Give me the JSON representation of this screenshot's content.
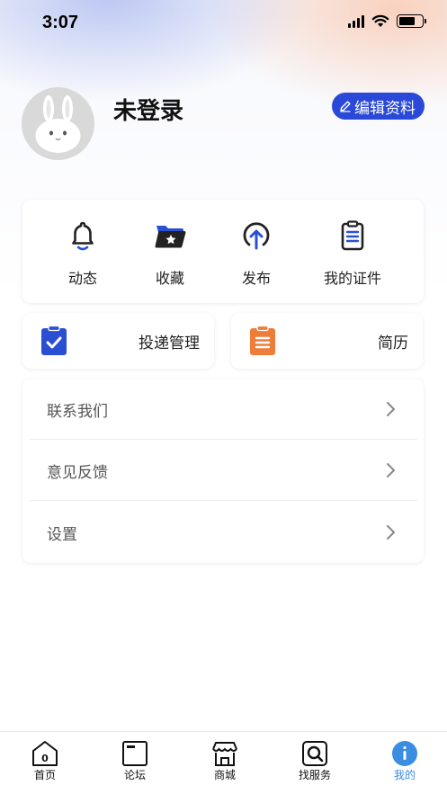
{
  "status_bar": {
    "time": "3:07"
  },
  "profile": {
    "username": "未登录",
    "edit_label": "编辑资料"
  },
  "quick_actions": [
    {
      "label": "动态",
      "icon": "bell-icon"
    },
    {
      "label": "收藏",
      "icon": "folder-star-icon"
    },
    {
      "label": "发布",
      "icon": "upload-circle-icon"
    },
    {
      "label": "我的证件",
      "icon": "clipboard-list-icon"
    }
  ],
  "cards": {
    "delivery": {
      "label": "投递管理",
      "icon": "clipboard-check-icon",
      "color": "#2b4fd3"
    },
    "resume": {
      "label": "简历",
      "icon": "clipboard-document-icon",
      "color": "#ee7d3a"
    }
  },
  "menu": [
    {
      "label": "联系我们"
    },
    {
      "label": "意见反馈"
    },
    {
      "label": "设置"
    }
  ],
  "tabbar": {
    "tabs": [
      {
        "label": "首页",
        "icon": "home-icon",
        "badge": "0"
      },
      {
        "label": "论坛",
        "icon": "forum-icon"
      },
      {
        "label": "商城",
        "icon": "store-icon"
      },
      {
        "label": "找服务",
        "icon": "search-service-icon"
      },
      {
        "label": "我的",
        "icon": "profile-icon",
        "active": true
      }
    ],
    "active_color": "#3a8de0"
  },
  "colors": {
    "accent": "#2a49d8",
    "orange": "#ee7d3a",
    "blue": "#2b4fd3"
  }
}
